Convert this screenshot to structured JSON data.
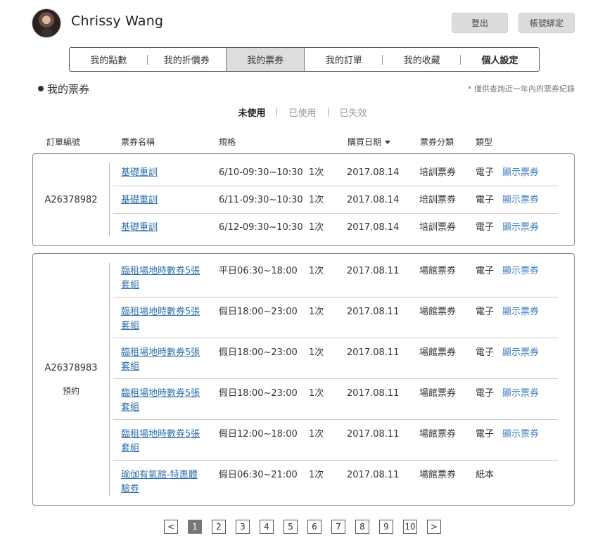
{
  "user": {
    "name": "Chrissy Wang"
  },
  "header": {
    "logout_label": "登出",
    "bind_label": "帳號綁定"
  },
  "tabs": [
    {
      "label": "我的點數"
    },
    {
      "label": "我的折價券"
    },
    {
      "label": "我的票券"
    },
    {
      "label": "我的訂單"
    },
    {
      "label": "我的收藏"
    },
    {
      "label": "個人設定"
    }
  ],
  "section": {
    "title": "我的票券",
    "note": "* 僅供查詢近一年內的票券紀錄"
  },
  "filters": [
    {
      "label": "未使用"
    },
    {
      "label": "已使用"
    },
    {
      "label": "已失效"
    }
  ],
  "columns": {
    "order_no": "訂單編號",
    "name": "票券名稱",
    "spec": "規格",
    "date": "購買日期",
    "category": "票券分類",
    "type": "類型"
  },
  "orders": [
    {
      "id": "A26378982",
      "tag": "",
      "tickets": [
        {
          "name": "基礎重訓",
          "spec": "6/10-09:30~10:30",
          "qty": "1次",
          "date": "2017.08.14",
          "category": "培訓票券",
          "type": "電子",
          "action": "顯示票券"
        },
        {
          "name": "基礎重訓",
          "spec": "6/11-09:30~10:30",
          "qty": "1次",
          "date": "2017.08.14",
          "category": "培訓票券",
          "type": "電子",
          "action": "顯示票券"
        },
        {
          "name": "基礎重訓",
          "spec": "6/12-09:30~10:30",
          "qty": "1次",
          "date": "2017.08.14",
          "category": "培訓票券",
          "type": "電子",
          "action": "顯示票券"
        }
      ]
    },
    {
      "id": "A26378983",
      "tag": "預約",
      "tickets": [
        {
          "name": "臨租場地時數券5張套組",
          "spec": "平日06:30~18:00",
          "qty": "1次",
          "date": "2017.08.11",
          "category": "場館票券",
          "type": "電子",
          "action": "顯示票券"
        },
        {
          "name": "臨租場地時數券5張套組",
          "spec": "假日18:00~23:00",
          "qty": "1次",
          "date": "2017.08.11",
          "category": "場館票券",
          "type": "電子",
          "action": "顯示票券"
        },
        {
          "name": "臨租場地時數券5張套組",
          "spec": "假日18:00~23:00",
          "qty": "1次",
          "date": "2017.08.11",
          "category": "場館票券",
          "type": "電子",
          "action": "顯示票券"
        },
        {
          "name": "臨租場地時數券5張套組",
          "spec": "假日18:00~23:00",
          "qty": "1次",
          "date": "2017.08.11",
          "category": "場館票券",
          "type": "電子",
          "action": "顯示票券"
        },
        {
          "name": "臨租場地時數券5張套組",
          "spec": "假日12:00~18:00",
          "qty": "1次",
          "date": "2017.08.11",
          "category": "場館票券",
          "type": "電子",
          "action": "顯示票券"
        },
        {
          "name": "瑜伽有氧館-特惠體驗券",
          "spec": "假日06:30~21:00",
          "qty": "1次",
          "date": "2017.08.11",
          "category": "場館票券",
          "type": "紙本",
          "action": ""
        }
      ]
    }
  ],
  "pagination": {
    "prev": "<",
    "next": ">",
    "pages": [
      "1",
      "2",
      "3",
      "4",
      "5",
      "6",
      "7",
      "8",
      "9",
      "10"
    ]
  }
}
